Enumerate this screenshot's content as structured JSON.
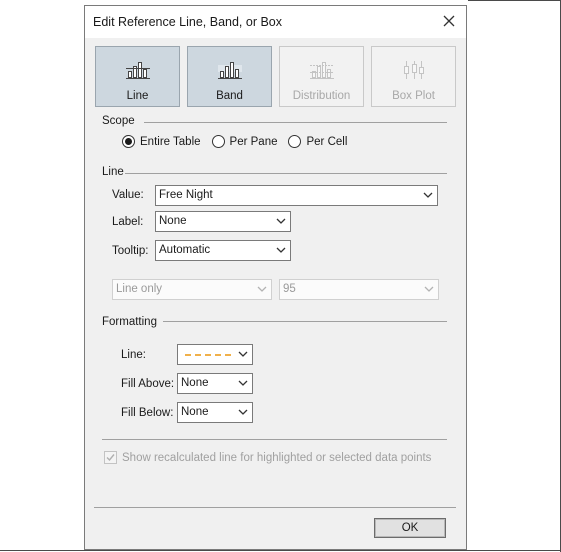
{
  "dialog": {
    "title": "Edit Reference Line, Band, or Box"
  },
  "type_buttons": [
    {
      "label": "Line",
      "state": "selected"
    },
    {
      "label": "Band",
      "state": "active"
    },
    {
      "label": "Distribution",
      "state": "disabled"
    },
    {
      "label": "Box Plot",
      "state": "disabled"
    }
  ],
  "scope": {
    "label": "Scope",
    "options": [
      "Entire Table",
      "Per Pane",
      "Per Cell"
    ],
    "selected": "Entire Table"
  },
  "line": {
    "label": "Line",
    "value_label": "Value:",
    "value": "Free Night",
    "label_label": "Label:",
    "label_value": "None",
    "tooltip_label": "Tooltip:",
    "tooltip_value": "Automatic",
    "display_value": "Line only",
    "confidence_value": "95"
  },
  "formatting": {
    "label": "Formatting",
    "line_label": "Line:",
    "line_color": "#f0b04a",
    "fill_above_label": "Fill Above:",
    "fill_above_value": "None",
    "fill_below_label": "Fill Below:",
    "fill_below_value": "None"
  },
  "recalc": {
    "label": "Show recalculated line for highlighted or selected data points",
    "checked": true,
    "enabled": false
  },
  "ok_label": "OK"
}
